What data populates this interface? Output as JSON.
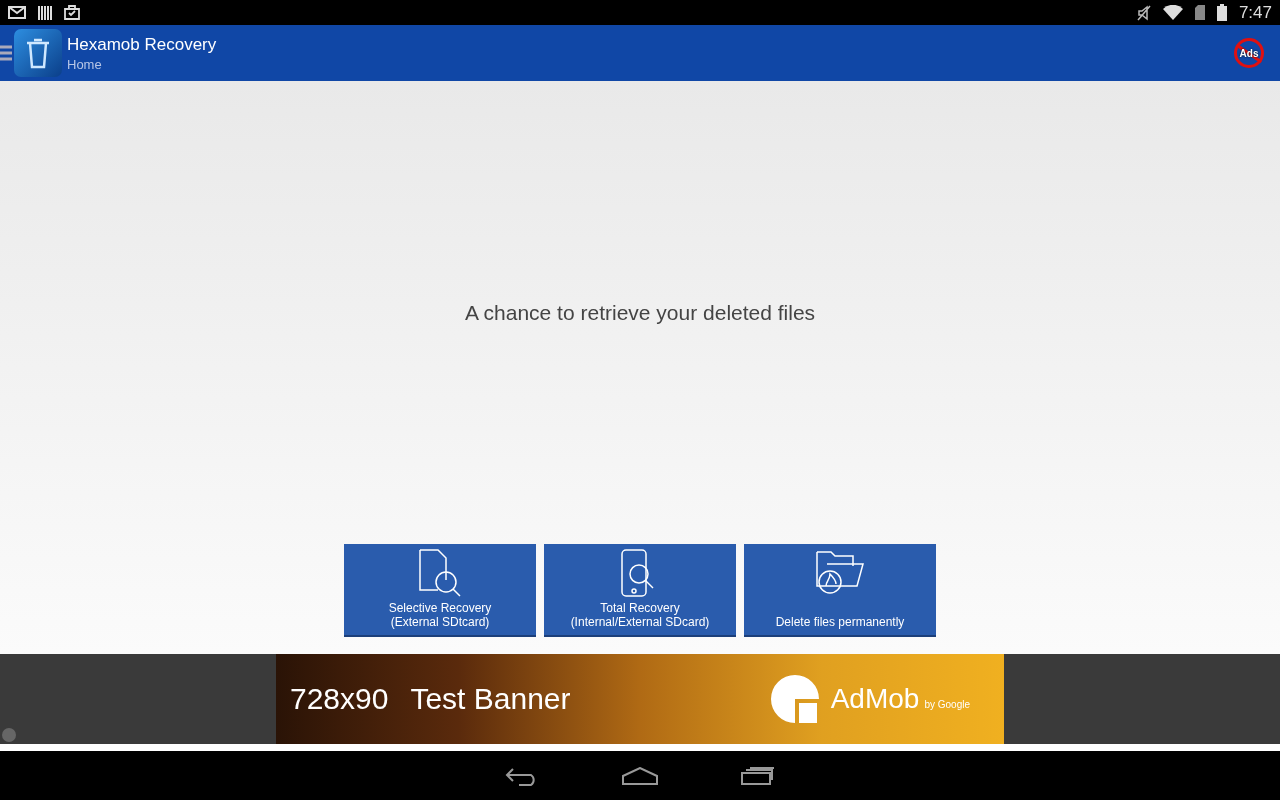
{
  "status_bar": {
    "time": "7:47"
  },
  "app_bar": {
    "title": "Hexamob Recovery",
    "subtitle": "Home",
    "ads_label": "Ads"
  },
  "headline": "A chance to retrieve your deleted files",
  "actions": [
    {
      "kind": "document",
      "lines": [
        "Selective Recovery",
        "(External SDtcard)"
      ]
    },
    {
      "kind": "phone",
      "lines": [
        "Total Recovery",
        "(Internal/External SDcard)"
      ]
    },
    {
      "kind": "folder",
      "lines": [
        "Delete files permanently"
      ]
    }
  ],
  "ad": {
    "size": "728x90",
    "label": "Test Banner",
    "brand": "AdMob",
    "byline": "by Google"
  }
}
